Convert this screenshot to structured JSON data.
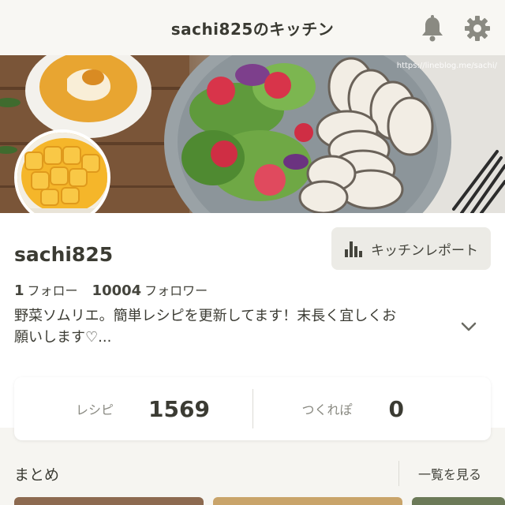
{
  "header": {
    "title": "sachi825のキッチン",
    "icons": [
      "bell-icon",
      "gear-icon"
    ]
  },
  "cover": {
    "watermark": "https://lineblog.me/sachi/"
  },
  "profile": {
    "username": "sachi825",
    "report_button": "キッチンレポート",
    "following_count": "1",
    "following_label": "フォロー",
    "followers_count": "10004",
    "followers_label": "フォロワー",
    "bio_line1": "野菜ソムリエ。簡単レシピを更新してます！末長く宜しくお",
    "bio_line2": "願いします♡..."
  },
  "stats": {
    "recipes_label": "レシピ",
    "recipes_value": "1569",
    "tsukurepo_label": "つくれぽ",
    "tsukurepo_value": "0"
  },
  "collection": {
    "title": "まとめ",
    "see_all": "一覧を見る"
  },
  "colors": {
    "background": "#f6f5f1",
    "text": "#3a3a32",
    "button_bg": "#ecebe6"
  }
}
